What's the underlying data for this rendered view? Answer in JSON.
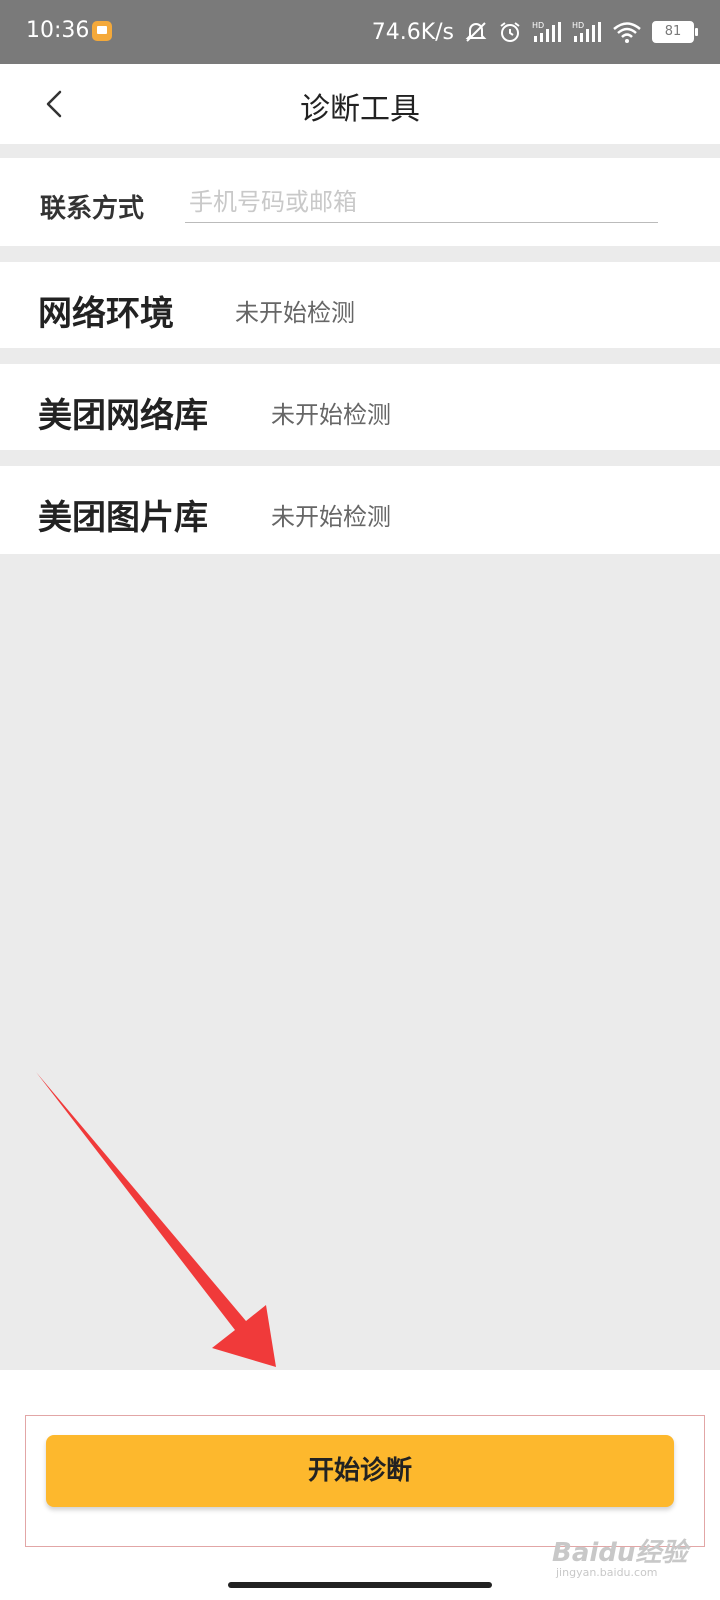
{
  "status_bar": {
    "time": "10:36",
    "net_speed": "74.6K/s",
    "battery": "81",
    "signal_label_1": "HD",
    "signal_label_2": "HD"
  },
  "header": {
    "title": "诊断工具"
  },
  "contact": {
    "label": "联系方式",
    "placeholder": "手机号码或邮箱",
    "value": ""
  },
  "checks": [
    {
      "label": "网络环境",
      "status": "未开始检测"
    },
    {
      "label": "美团网络库",
      "status": "未开始检测"
    },
    {
      "label": "美团图片库",
      "status": "未开始检测"
    }
  ],
  "actions": {
    "start_label": "开始诊断"
  },
  "watermark": {
    "brand": "Baidu经验",
    "url": "jingyan.baidu.com"
  },
  "colors": {
    "accent": "#fdb82d",
    "annotation_arrow": "#f03a3a",
    "background": "#ebebeb"
  }
}
